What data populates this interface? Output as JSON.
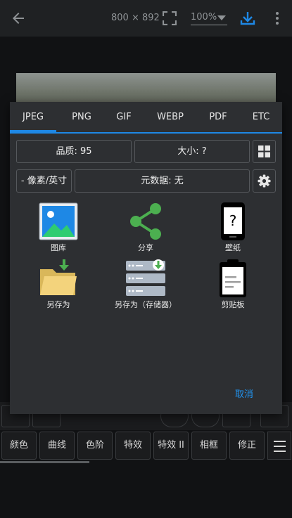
{
  "topbar": {
    "dimensions": "800 × 892",
    "zoom": "100%"
  },
  "dialog": {
    "tabs": [
      "JPEG",
      "PNG",
      "GIF",
      "WEBP",
      "PDF",
      "ETC"
    ],
    "active_tab": "JPEG",
    "quality": "品质: 95",
    "size": "大小: ?",
    "ppi": "- 像素/英寸",
    "metadata": "元数据: 无",
    "actions": {
      "gallery": "图库",
      "share": "分享",
      "wallpaper": "壁纸",
      "save_as": "另存为",
      "save_as_storage": "另存为（存储器）",
      "clipboard": "剪贴板"
    },
    "cancel": "取消"
  },
  "bottom_tabs": [
    "颜色",
    "曲线",
    "色阶",
    "特效",
    "特效 II",
    "相框",
    "修正"
  ],
  "colors": {
    "accent": "#1e88e5",
    "share_green": "#4caf50",
    "folder_yellow": "#f3d37c"
  }
}
